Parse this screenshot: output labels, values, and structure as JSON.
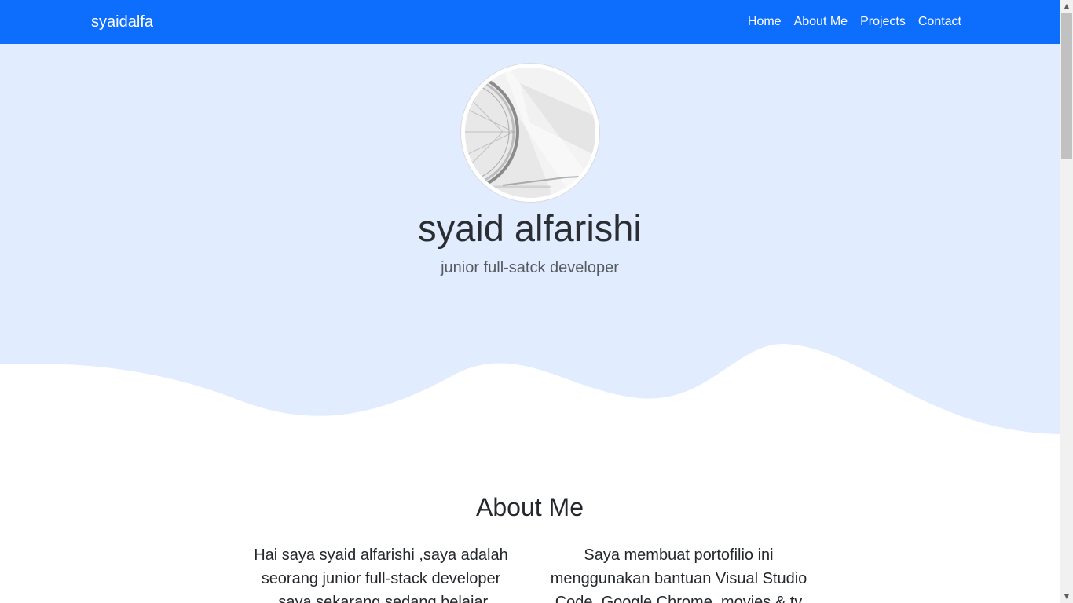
{
  "navbar": {
    "brand": "syaidalfa",
    "links": [
      {
        "label": "Home"
      },
      {
        "label": "About Me"
      },
      {
        "label": "Projects"
      },
      {
        "label": "Contact"
      }
    ],
    "background_color": "#0d6efd"
  },
  "hero": {
    "name": "syaid alfarishi",
    "subtitle": "junior full-satck developer",
    "background_color": "#e2ecff"
  },
  "about": {
    "title": "About Me",
    "left_text": "Hai saya syaid alfarishi ,saya adalah seorang junior full-stack developer ,saya sekarang sedang belajar membangun",
    "right_text": "Saya membuat portofilio ini menggunakan bantuan Visual Studio Code, Google Chrome, movies & tv"
  },
  "icons": {
    "scroll_up": "scroll-up-icon",
    "scroll_down": "scroll-down-icon"
  }
}
